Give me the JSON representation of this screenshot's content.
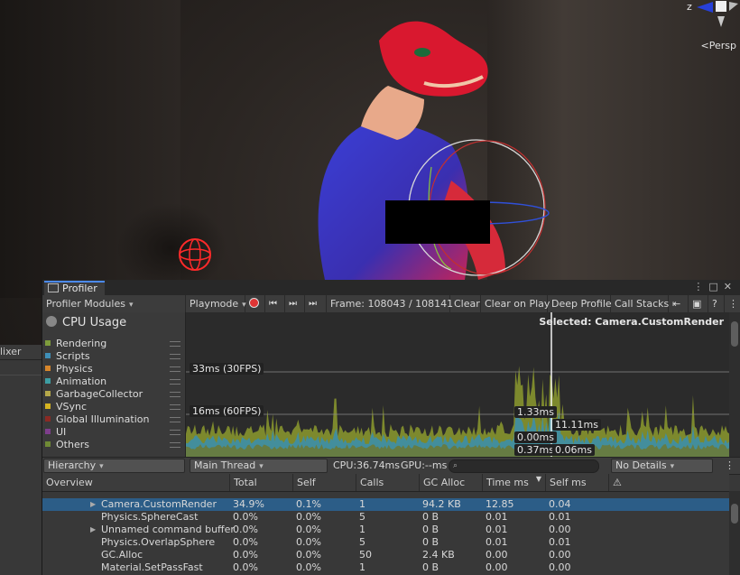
{
  "scene": {
    "gizmo_axis": "z",
    "projection": "Persp",
    "left_panel_tab": "lixer"
  },
  "profiler": {
    "tab_title": "Profiler",
    "toolbar": {
      "modules_label": "Profiler Modules",
      "playmode_label": "Playmode",
      "frame_label": "Frame: 108043 / 108141",
      "clear": "Clear",
      "clear_on_play": "Clear on Play",
      "deep_profile": "Deep Profile",
      "call_stacks": "Call Stacks"
    },
    "module": {
      "title": "CPU Usage",
      "legend": [
        {
          "label": "Rendering",
          "color": "#7e9c3c"
        },
        {
          "label": "Scripts",
          "color": "#3f8fb8"
        },
        {
          "label": "Physics",
          "color": "#d7862b"
        },
        {
          "label": "Animation",
          "color": "#3d9ea3"
        },
        {
          "label": "GarbageCollector",
          "color": "#b5a84a"
        },
        {
          "label": "VSync",
          "color": "#d6b421"
        },
        {
          "label": "Global Illumination",
          "color": "#8b2a24"
        },
        {
          "label": "UI",
          "color": "#7e3e8c"
        },
        {
          "label": "Others",
          "color": "#6f8a35"
        }
      ]
    },
    "graph": {
      "selected": "Selected: Camera.CustomRender",
      "line_33": "33ms (30FPS)",
      "line_16": "16ms (60FPS)",
      "marker_labels": [
        "1.33ms",
        "11.11ms",
        "0.00ms",
        "0.37ms",
        "0.06ms"
      ]
    },
    "detail": {
      "view": "Hierarchy",
      "thread": "Main Thread",
      "cpu": "CPU:36.74ms",
      "gpu": "GPU:--ms",
      "details": "No Details"
    },
    "columns": [
      "Overview",
      "Total",
      "Self",
      "Calls",
      "GC Alloc",
      "Time ms",
      "Self ms",
      "⚠"
    ],
    "rows": [
      {
        "name": "Camera.CustomRender",
        "total": "34.9%",
        "self": "0.1%",
        "calls": "1",
        "gc": "94.2 KB",
        "time": "12.85",
        "self_ms": "0.04",
        "expandable": true,
        "selected": true
      },
      {
        "name": "Physics.SphereCast",
        "total": "0.0%",
        "self": "0.0%",
        "calls": "5",
        "gc": "0 B",
        "time": "0.01",
        "self_ms": "0.01",
        "expandable": false,
        "selected": false
      },
      {
        "name": "Unnamed command buffer",
        "total": "0.0%",
        "self": "0.0%",
        "calls": "1",
        "gc": "0 B",
        "time": "0.01",
        "self_ms": "0.00",
        "expandable": true,
        "selected": false
      },
      {
        "name": "Physics.OverlapSphere",
        "total": "0.0%",
        "self": "0.0%",
        "calls": "5",
        "gc": "0 B",
        "time": "0.01",
        "self_ms": "0.01",
        "expandable": false,
        "selected": false
      },
      {
        "name": "GC.Alloc",
        "total": "0.0%",
        "self": "0.0%",
        "calls": "50",
        "gc": "2.4 KB",
        "time": "0.00",
        "self_ms": "0.00",
        "expandable": false,
        "selected": false
      },
      {
        "name": "Material.SetPassFast",
        "total": "0.0%",
        "self": "0.0%",
        "calls": "1",
        "gc": "0 B",
        "time": "0.00",
        "self_ms": "0.00",
        "expandable": false,
        "selected": false
      }
    ]
  }
}
